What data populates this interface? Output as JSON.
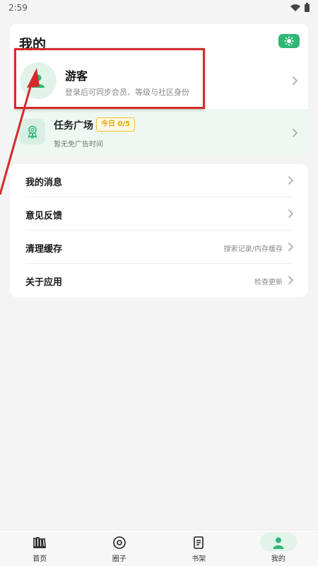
{
  "status_bar": {
    "time": "2:59"
  },
  "header": {
    "title": "我的"
  },
  "profile": {
    "name": "游客",
    "subtitle": "登录后可同步会员、等级与社区身份"
  },
  "task": {
    "title": "任务广场",
    "badge": "今日 0/5",
    "subtitle": "暂无免广告时间"
  },
  "menu": {
    "items": [
      {
        "label": "我的消息",
        "value": ""
      },
      {
        "label": "意见反馈",
        "value": ""
      },
      {
        "label": "清理缓存",
        "value": "搜索记录/内存缓存"
      },
      {
        "label": "关于应用",
        "value": "检查更新"
      }
    ]
  },
  "bottom_nav": {
    "items": [
      {
        "label": "首页",
        "icon": "books-icon"
      },
      {
        "label": "圈子",
        "icon": "circle-icon"
      },
      {
        "label": "书架",
        "icon": "document-icon"
      },
      {
        "label": "我的",
        "icon": "person-icon",
        "active": true
      }
    ]
  },
  "colors": {
    "accent": "#2fb776",
    "annotation": "#d52a2a",
    "badge": "#f2c23c"
  }
}
